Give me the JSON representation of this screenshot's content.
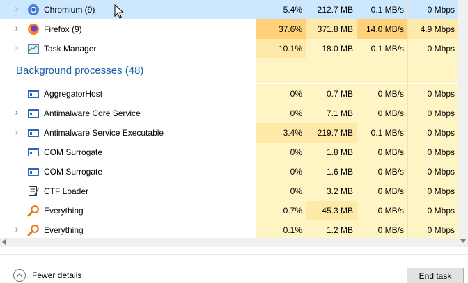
{
  "colors": {
    "selected_row": "#cce8ff",
    "heat_light": "#fff4c4",
    "heat_medium": "#ffe9a8",
    "heat_strong": "#ffd279",
    "group_title": "#1a5fa8",
    "sort_line": "#e0785a"
  },
  "apps": [
    {
      "name": "Chromium (9)",
      "icon": "chromium-icon",
      "expandable": true,
      "selected": true,
      "cpu": "5.4%",
      "memory": "212.7 MB",
      "disk": "0.1 MB/s",
      "network": "0 Mbps",
      "heat": [
        "selected",
        "selected",
        "selected",
        "selected"
      ]
    },
    {
      "name": "Firefox (9)",
      "icon": "firefox-icon",
      "expandable": true,
      "selected": false,
      "cpu": "37.6%",
      "memory": "371.8 MB",
      "disk": "14.0 MB/s",
      "network": "4.9 Mbps",
      "heat": [
        "strong",
        "medium",
        "strong",
        "medium"
      ]
    },
    {
      "name": "Task Manager",
      "icon": "task-manager-icon",
      "expandable": true,
      "selected": false,
      "cpu": "10.1%",
      "memory": "18.0 MB",
      "disk": "0.1 MB/s",
      "network": "0 Mbps",
      "heat": [
        "medium",
        "light",
        "light",
        "light"
      ]
    }
  ],
  "background_group": {
    "title": "Background processes (48)"
  },
  "background": [
    {
      "name": "AggregatorHost",
      "icon": "window-app-icon",
      "expandable": false,
      "cpu": "0%",
      "memory": "0.7 MB",
      "disk": "0 MB/s",
      "network": "0 Mbps",
      "heat": [
        "light",
        "light",
        "light",
        "light"
      ]
    },
    {
      "name": "Antimalware Core Service",
      "icon": "window-app-icon",
      "expandable": true,
      "cpu": "0%",
      "memory": "7.1 MB",
      "disk": "0 MB/s",
      "network": "0 Mbps",
      "heat": [
        "light",
        "light",
        "light",
        "light"
      ]
    },
    {
      "name": "Antimalware Service Executable",
      "icon": "window-app-icon",
      "expandable": true,
      "cpu": "3.4%",
      "memory": "219.7 MB",
      "disk": "0.1 MB/s",
      "network": "0 Mbps",
      "heat": [
        "medium",
        "medium",
        "light",
        "light"
      ]
    },
    {
      "name": "COM Surrogate",
      "icon": "window-app-icon",
      "expandable": false,
      "cpu": "0%",
      "memory": "1.8 MB",
      "disk": "0 MB/s",
      "network": "0 Mbps",
      "heat": [
        "light",
        "light",
        "light",
        "light"
      ]
    },
    {
      "name": "COM Surrogate",
      "icon": "window-app-icon",
      "expandable": false,
      "cpu": "0%",
      "memory": "1.6 MB",
      "disk": "0 MB/s",
      "network": "0 Mbps",
      "heat": [
        "light",
        "light",
        "light",
        "light"
      ]
    },
    {
      "name": "CTF Loader",
      "icon": "ctf-loader-icon",
      "expandable": false,
      "cpu": "0%",
      "memory": "3.2 MB",
      "disk": "0 MB/s",
      "network": "0 Mbps",
      "heat": [
        "light",
        "light",
        "light",
        "light"
      ]
    },
    {
      "name": "Everything",
      "icon": "everything-search-icon",
      "expandable": false,
      "cpu": "0.7%",
      "memory": "45.3 MB",
      "disk": "0 MB/s",
      "network": "0 Mbps",
      "heat": [
        "light",
        "medium",
        "light",
        "light"
      ]
    },
    {
      "name": "Everything",
      "icon": "everything-search-icon",
      "expandable": true,
      "cpu": "0.1%",
      "memory": "1.2 MB",
      "disk": "0 MB/s",
      "network": "0 Mbps",
      "heat": [
        "light",
        "light",
        "light",
        "light"
      ]
    }
  ],
  "footer": {
    "fewer_details": "Fewer details",
    "end_task": "End task"
  }
}
